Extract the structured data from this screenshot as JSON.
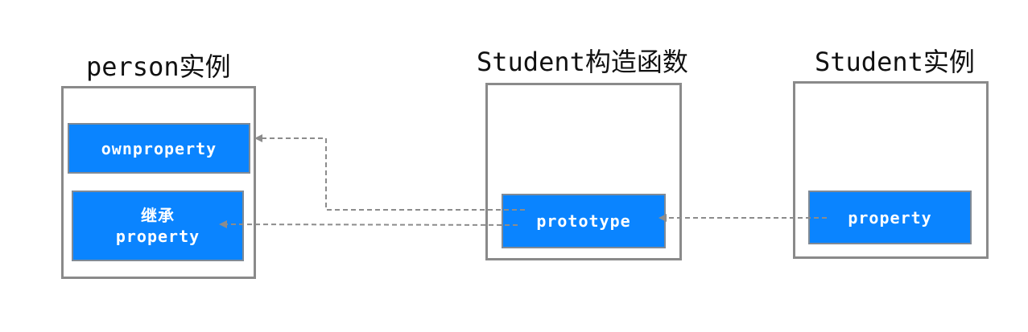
{
  "groups": {
    "person": {
      "title": "person实例"
    },
    "constructor": {
      "title": "Student构造函数"
    },
    "student": {
      "title": "Student实例"
    }
  },
  "nodes": {
    "ownproperty": {
      "label": "ownproperty"
    },
    "inherited": {
      "line1": "继承",
      "line2": "property"
    },
    "prototype": {
      "label": "prototype"
    },
    "property": {
      "label": "property"
    }
  },
  "colors": {
    "node_fill": "#0a84ff",
    "frame_border": "#8a8a8a",
    "arrow": "#8c8c8c"
  }
}
